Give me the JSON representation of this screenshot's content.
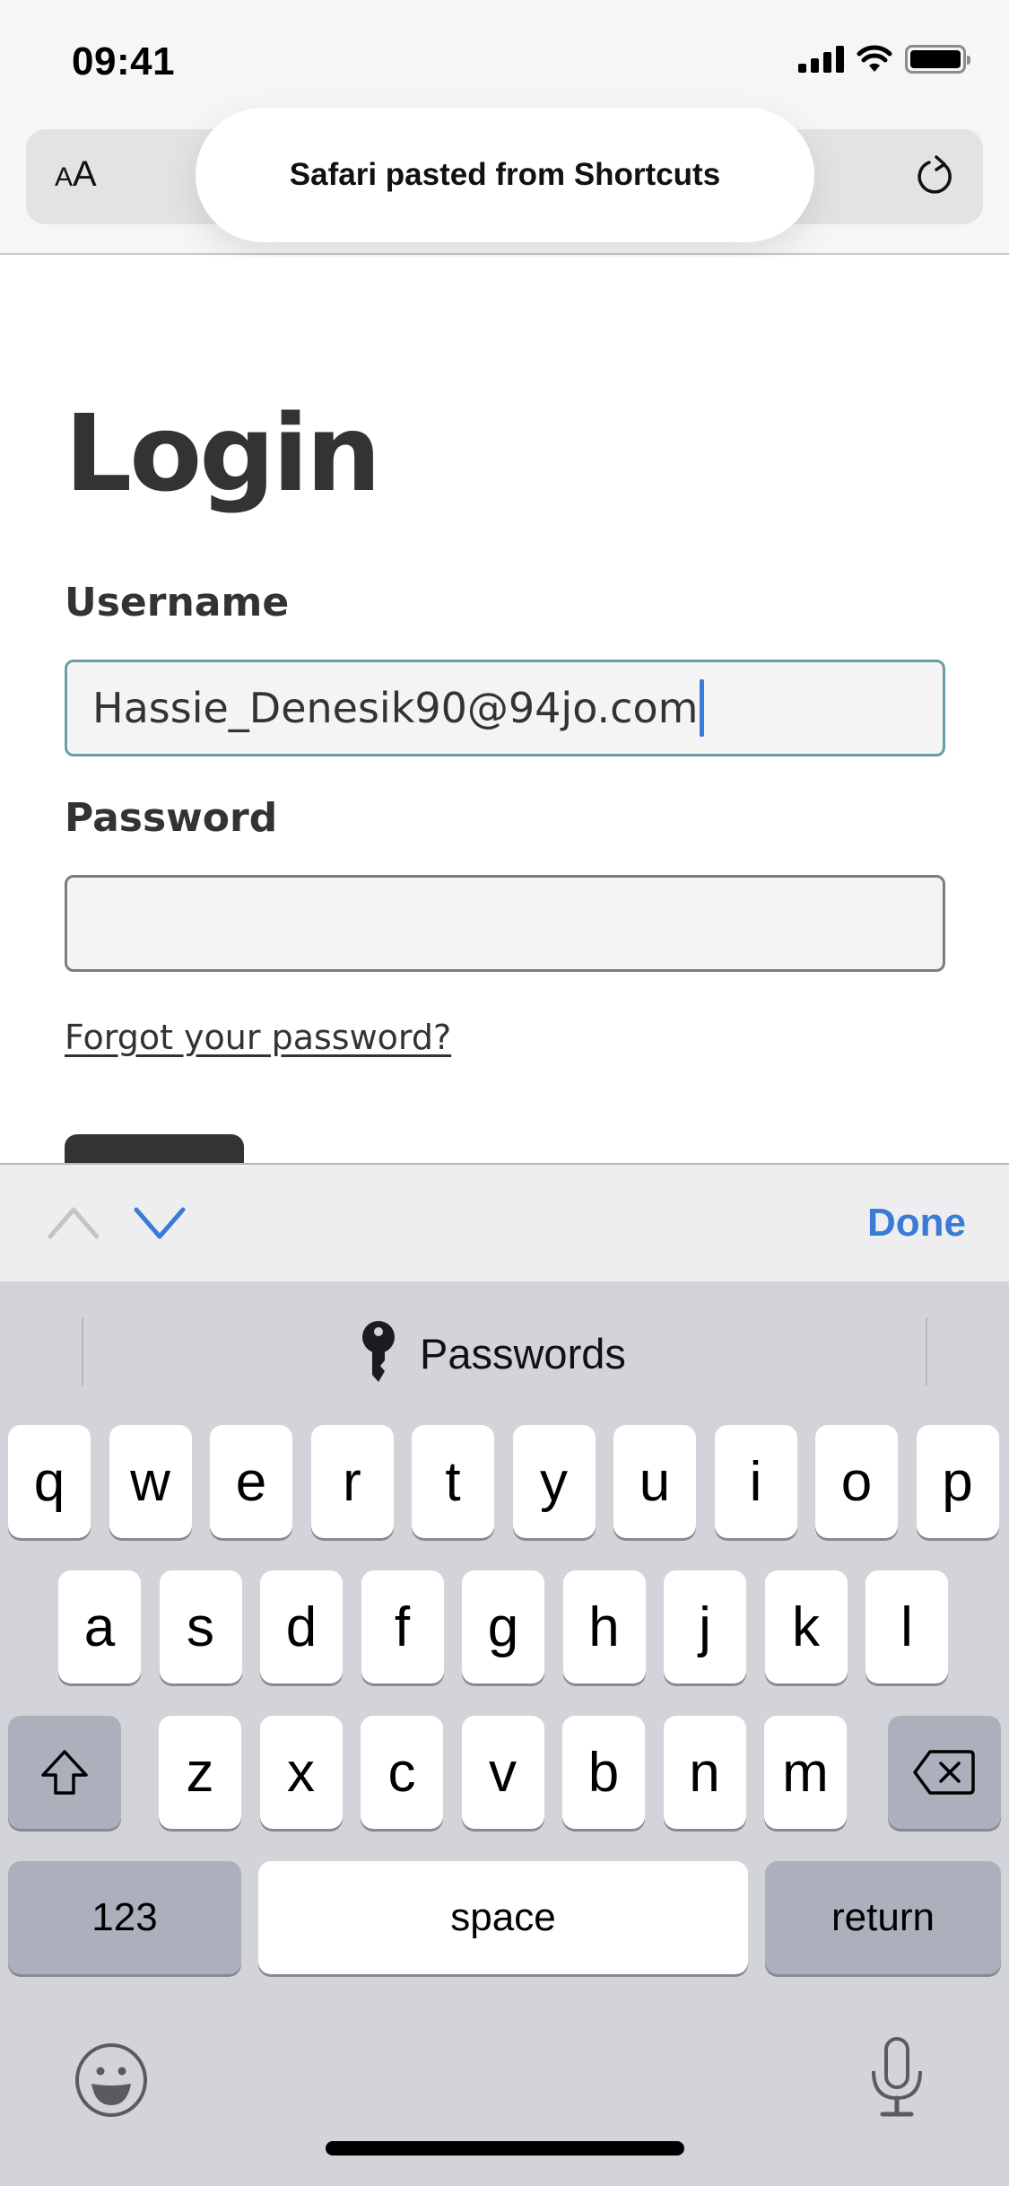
{
  "status_bar": {
    "time": "09:41",
    "icons": [
      "cellular-signal-icon",
      "wifi-icon",
      "battery-icon"
    ]
  },
  "safari": {
    "text_size_button": {
      "small": "A",
      "large": "A"
    },
    "reload_icon": "reload-icon",
    "toast": "Safari pasted from Shortcuts"
  },
  "page": {
    "title": "Login",
    "username": {
      "label": "Username",
      "value": "Hassie_Denesik90@94jo.com",
      "focused": true
    },
    "password": {
      "label": "Password",
      "value": ""
    },
    "forgot_link": "Forgot your password?"
  },
  "accessory_bar": {
    "prev_icon": "chevron-up-icon",
    "next_icon": "chevron-down-icon",
    "done_label": "Done",
    "accent_color": "#3a7bd5"
  },
  "keyboard": {
    "suggestion": {
      "icon": "key-icon",
      "label": "Passwords"
    },
    "rows": [
      [
        "q",
        "w",
        "e",
        "r",
        "t",
        "y",
        "u",
        "i",
        "o",
        "p"
      ],
      [
        "a",
        "s",
        "d",
        "f",
        "g",
        "h",
        "j",
        "k",
        "l"
      ],
      [
        "z",
        "x",
        "c",
        "v",
        "b",
        "n",
        "m"
      ]
    ],
    "shift_icon": "shift-icon",
    "delete_icon": "delete-icon",
    "numbers_label": "123",
    "space_label": "space",
    "return_label": "return",
    "emoji_icon": "emoji-icon",
    "dictation_icon": "microphone-icon"
  }
}
